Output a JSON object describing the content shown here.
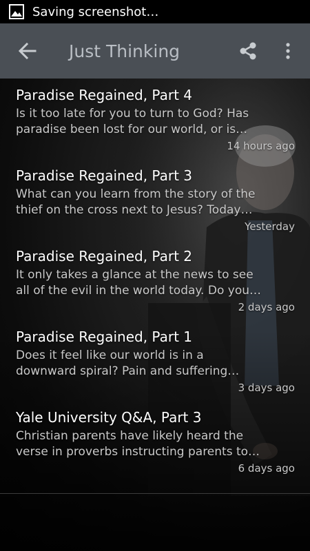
{
  "status_bar": {
    "notification_icon": "image-icon",
    "text": "Saving screenshot…"
  },
  "action_bar": {
    "back_icon": "arrow-back-icon",
    "title": "Just Thinking",
    "share_icon": "share-icon",
    "overflow_icon": "more-vertical-icon"
  },
  "episodes": [
    {
      "title": "Paradise Regained, Part 4",
      "desc_line1": "Is it too late for you to turn to God? Has",
      "desc_line2": "paradise been lost for our world, or is…",
      "time": "14 hours ago"
    },
    {
      "title": "Paradise Regained, Part 3",
      "desc_line1": "What can you learn from the story of the",
      "desc_line2": "thief on the cross next to Jesus? Today…",
      "time": "Yesterday"
    },
    {
      "title": "Paradise Regained, Part 2",
      "desc_line1": "It only takes a glance at the news to see",
      "desc_line2": "all of the evil in the world today. Do you…",
      "time": "2 days ago"
    },
    {
      "title": "Paradise Regained, Part 1",
      "desc_line1": "Does it feel like our world is in a",
      "desc_line2": "downward spiral? Pain and suffering…",
      "time": "3 days ago"
    },
    {
      "title": "Yale University Q&A, Part 3",
      "desc_line1": "Christian parents have likely heard the",
      "desc_line2": "verse in proverbs instructing parents to…",
      "time": "6 days ago"
    }
  ],
  "colors": {
    "action_bar": "#4a4f55",
    "title_text": "#b9bec4",
    "item_title": "#ffffff",
    "item_desc": "#c9c9c9"
  }
}
